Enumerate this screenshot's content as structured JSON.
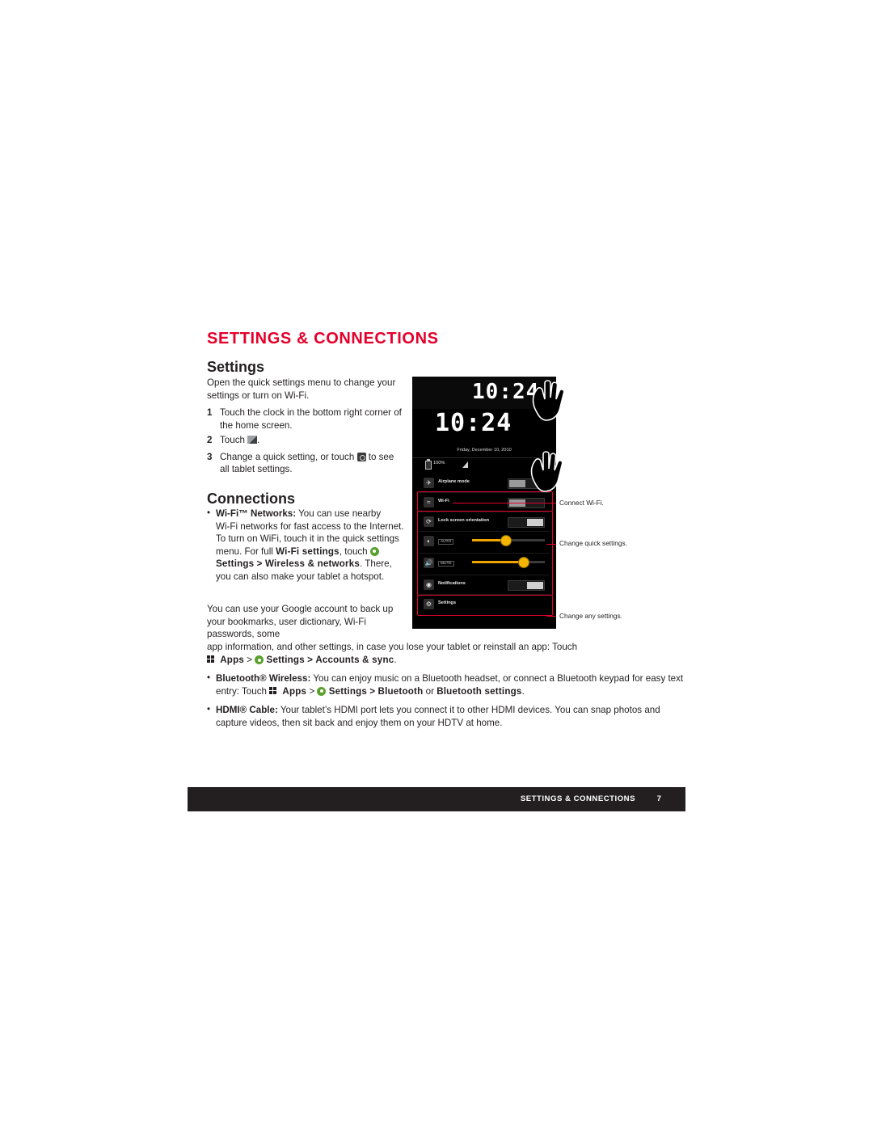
{
  "headings": {
    "title": "SETTINGS & CONNECTIONS",
    "settings": "Settings",
    "connections": "Connections"
  },
  "settings_section": {
    "intro": "Open the quick settings menu to change your settings or turn on Wi‑Fi.",
    "steps": [
      {
        "num": "1",
        "text": "Touch the clock in the bottom right corner of the home screen."
      },
      {
        "num": "2",
        "text_before": "Touch",
        "icon": "pencil-icon",
        "text_after": "."
      },
      {
        "num": "3",
        "text_before": "Change a quick setting, or touch",
        "icon": "quick-settings-icon",
        "text_after": "to see all tablet settings."
      }
    ]
  },
  "connections_section": {
    "bullets": [
      {
        "label": "Wi‑Fi™ Networks:",
        "body": "You can use nearby Wi‑Fi networks for fast access to the Internet. To turn on WiFi, touch it in the quick settings menu. For full",
        "bold_run1": "Wi-Fi settings",
        "run1_tail": ", touch",
        "icon": "settings-gear-icon",
        "bold_run2": "Settings",
        "bold_run3": "> Wireless & networks",
        "run3_tail": ". There, you can also make your tablet a hotspot."
      }
    ],
    "google_paragraph": "You can use your Google account to back up your bookmarks, user dictionary, Wi‑Fi passwords, some app information, and other settings, in case you lose your tablet or reinstall an app: Touch",
    "google_path": {
      "apps": "Apps",
      "sep1": ">",
      "settings": "Settings",
      "sep2": ">",
      "accounts": "Accounts & sync",
      "period": "."
    },
    "bluetooth": {
      "label": "Bluetooth® Wireless:",
      "body": "You can enjoy music on a Bluetooth headset, or connect a Bluetooth keypad for easy text entry: Touch",
      "apps": "Apps",
      "sep1": ">",
      "settings": "Settings",
      "sep2": ">",
      "opt1": "Bluetooth",
      "or": "or",
      "opt2": "Bluetooth settings",
      "period": "."
    },
    "hdmi": {
      "label": "HDMI® Cable:",
      "body": "Your tablet’s HDMI port lets you connect it to other HDMI devices. You can snap photos and capture videos, then sit back and enjoy them on your HDTV at home."
    }
  },
  "device": {
    "lcd_small": "10:24",
    "lcd_big": "10:24",
    "date": "Friday, December 10, 2010",
    "battery": "100%",
    "quick_settings": [
      {
        "icon": "airplane-icon",
        "label": "Airplane mode",
        "control": "toggle",
        "on": false
      },
      {
        "icon": "wifi-icon",
        "label": "Wi-Fi",
        "control": "toggle",
        "on": false
      },
      {
        "icon": "rotate-lock-icon",
        "label": "Lock screen orientation",
        "control": "toggle",
        "on": true
      },
      {
        "icon": "brightness-icon",
        "label": "AUTO",
        "control": "slider",
        "value": 45
      },
      {
        "icon": "volume-icon",
        "label": "MUTE",
        "control": "slider",
        "value": 70
      },
      {
        "icon": "notifications-icon",
        "label": "Notifications",
        "control": "toggle",
        "on": true
      },
      {
        "icon": "settings-icon",
        "label": "Settings",
        "control": "none"
      }
    ]
  },
  "callouts": [
    {
      "text": "Connect Wi-Fi."
    },
    {
      "text": "Change quick settings."
    },
    {
      "text": "Change any settings."
    }
  ],
  "footer": {
    "title": "SETTINGS & CONNECTIONS",
    "page": "7"
  },
  "colors": {
    "accent": "#e4002b",
    "text": "#231f20",
    "footer_bg": "#231f20",
    "green": "#5aa02c",
    "amber": "#f4b400"
  }
}
